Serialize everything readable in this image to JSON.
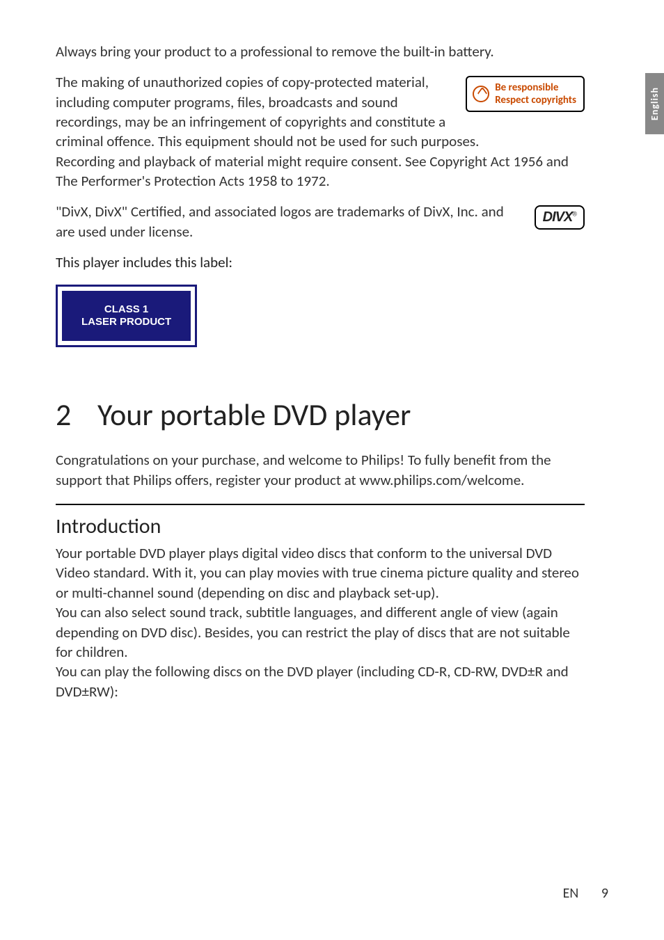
{
  "sideTab": "English",
  "para1": "Always bring your product to a professional to remove the built-in battery.",
  "copyrightBadge": {
    "line1": "Be responsible",
    "line2": "Respect copyrights"
  },
  "para2": "The making of unauthorized copies of copy-protected material, including computer programs, files, broadcasts and sound recordings, may be an infringement of copyrights and constitute a criminal offence. This equipment should not be used for such purposes.",
  "para3": "Recording and playback of material might require consent. See Copyright Act 1956 and The Performer's Protection Acts 1958 to 1972.",
  "divxBadge": "DIVX",
  "para4": "\"DivX, DivX\" Certified, and associated logos are trademarks of DivX, Inc. and are used under license.",
  "labelHeading": "This player includes this label:",
  "laserLabel": {
    "line1": "CLASS 1",
    "line2": "LASER PRODUCT"
  },
  "chapter": {
    "number": "2",
    "title": "Your portable DVD player"
  },
  "chapterIntro": "Congratulations on your purchase, and welcome to Philips! To fully benefit from the support that Philips offers, register your product at www.philips.com/welcome.",
  "section1": {
    "title": "Introduction",
    "p1": "Your portable DVD player plays digital video discs that conform to the universal DVD Video standard. With it, you can play movies with true cinema picture quality and stereo or multi-channel sound (depending on disc and playback set-up).",
    "p2": "You can also select sound track, subtitle languages, and different angle of view (again depending on DVD disc). Besides, you can restrict the play of discs that are not suitable for children.",
    "p3": "You can play the following discs on the DVD player (including CD-R, CD-RW, DVD±R and DVD±RW):"
  },
  "footer": {
    "lang": "EN",
    "page": "9"
  }
}
